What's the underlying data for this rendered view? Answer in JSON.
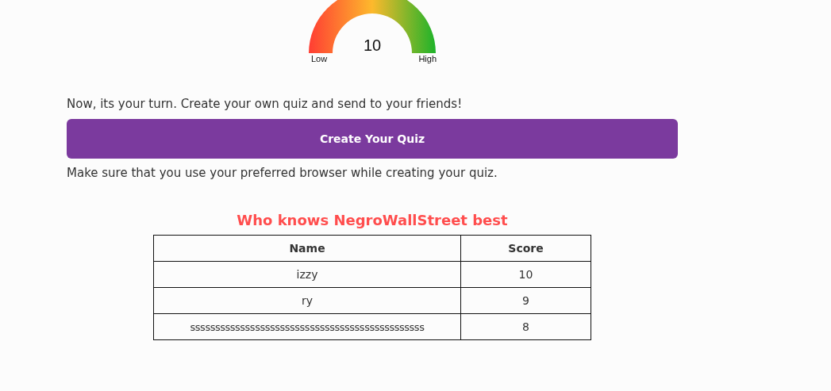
{
  "gauge": {
    "value": "10",
    "low_label": "Low",
    "high_label": "High"
  },
  "prompt": "Now, its your turn. Create your own quiz and send to your friends!",
  "create_button": "Create Your Quiz",
  "note": "Make sure that you use your preferred browser while creating your quiz.",
  "leaderboard": {
    "title": "Who knows NegroWallStreet best",
    "columns": [
      "Name",
      "Score"
    ],
    "rows": [
      [
        "izzy",
        "10"
      ],
      [
        "ry",
        "9"
      ],
      [
        "sssssssssssssssssssssssssssssssssssssssssssssss",
        "8"
      ]
    ]
  }
}
